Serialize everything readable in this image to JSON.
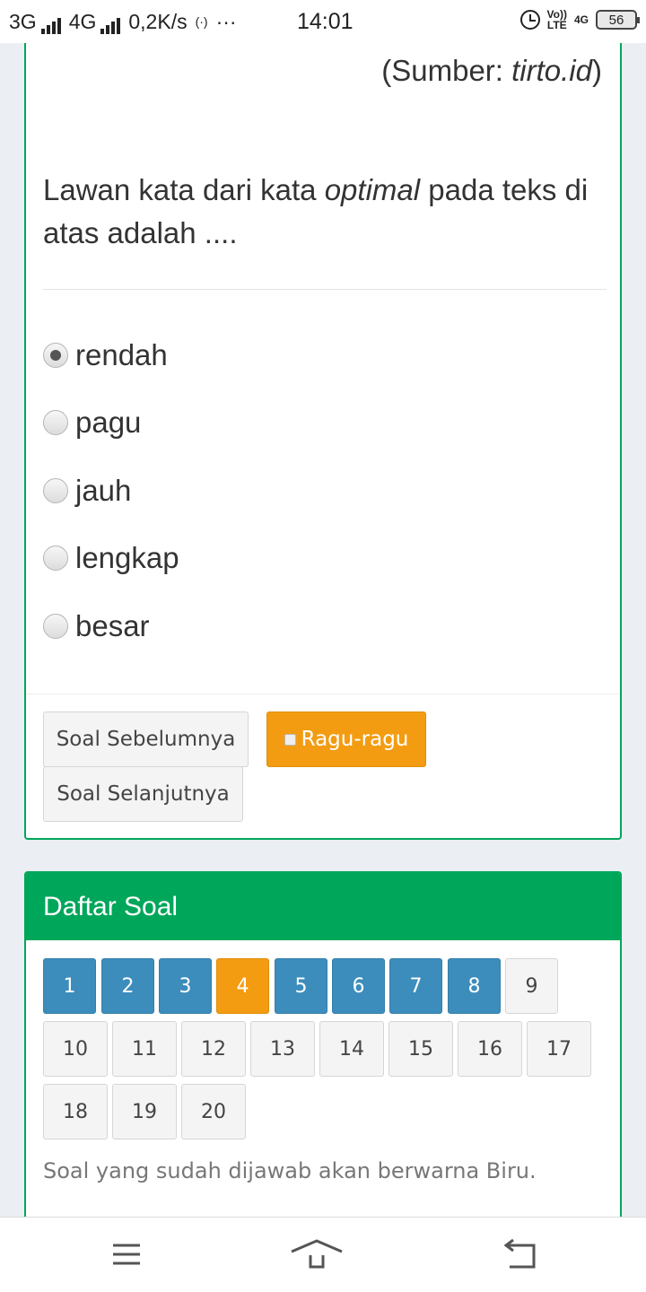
{
  "status_bar": {
    "net1": "3G",
    "net2": "4G",
    "speed": "0,2K/s",
    "more": "···",
    "time": "14:01",
    "volte": "Vo))",
    "lte": "LTE",
    "net3": "4G",
    "battery": "56"
  },
  "question": {
    "source_prefix": "(Sumber: ",
    "source_site": "tirto.id",
    "source_suffix": ")",
    "text_before": "Lawan kata dari kata ",
    "text_keyword": "optimal",
    "text_after": " pada teks di atas adalah ....",
    "options": [
      {
        "label": "rendah",
        "selected": true
      },
      {
        "label": "pagu",
        "selected": false
      },
      {
        "label": "jauh",
        "selected": false
      },
      {
        "label": "lengkap",
        "selected": false
      },
      {
        "label": "besar",
        "selected": false
      }
    ]
  },
  "buttons": {
    "prev": "Soal Sebelumnya",
    "doubt": "Ragu-ragu",
    "next": "Soal Selanjutnya"
  },
  "question_list": {
    "title": "Daftar Soal",
    "numbers": [
      "1",
      "2",
      "3",
      "4",
      "5",
      "6",
      "7",
      "8",
      "9",
      "10",
      "11",
      "12",
      "13",
      "14",
      "15",
      "16",
      "17",
      "18",
      "19",
      "20"
    ],
    "note": "Soal yang sudah dijawab akan berwarna Biru."
  },
  "colors": {
    "answered": "#3c8dbc",
    "doubt": "#f39c12",
    "unanswered": "#f4f4f4",
    "card_border": "#00a65a"
  }
}
